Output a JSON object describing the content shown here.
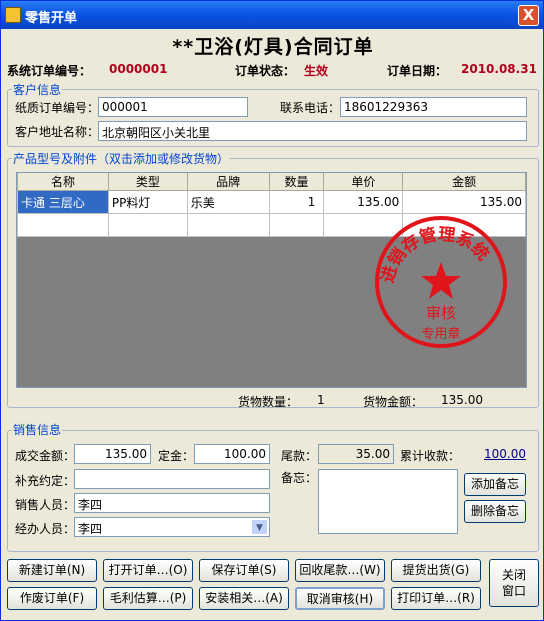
{
  "window": {
    "title": "零售开单",
    "close": "X"
  },
  "doc_title": "**卫浴(灯具)合同订单",
  "header": {
    "order_no_label": "系统订单编号：",
    "order_no": "0000001",
    "status_label": "订单状态：",
    "status": "生效",
    "date_label": "订单日期：",
    "date": "2010.08.31"
  },
  "customer": {
    "legend": "客户信息",
    "paper_no_label": "纸质订单编号：",
    "paper_no": "000001",
    "phone_label": "联系电话：",
    "phone": "18601229363",
    "address_label": "客户地址名称：",
    "address": "北京朝阳区小关北里"
  },
  "products": {
    "legend": "产品型号及附件（双击添加或修改货物）",
    "columns": [
      "名称",
      "类型",
      "品牌",
      "数量",
      "单价",
      "金额"
    ],
    "rows": [
      [
        "卡通 三层心",
        "PP料灯",
        "乐美",
        "1",
        "135.00",
        "135.00"
      ]
    ],
    "qty_label": "货物数量：",
    "qty_total": "1",
    "amount_label": "货物金额：",
    "amount_total": "135.00"
  },
  "stamp": {
    "top_text": "进销存管理系统",
    "mid_text": "审核",
    "bottom_text": "专用章",
    "color": "#e0141b"
  },
  "sales": {
    "legend": "销售信息",
    "deal_label": "成交金额：",
    "deal": "135.00",
    "deposit_label": "定金：",
    "deposit": "100.00",
    "balance_label": "尾款：",
    "balance": "35.00",
    "received_label": "累计收款：",
    "received": "100.00",
    "extra_label": "补充约定：",
    "extra": "",
    "note_label": "备忘：",
    "note": "",
    "seller_label": "销售人员：",
    "seller": "李四",
    "handler_label": "经办人员：",
    "handler": "李四",
    "add_note": "添加备忘",
    "del_note": "删除备忘"
  },
  "buttons": {
    "new": "新建订单(N)",
    "open": "打开订单…(O)",
    "save": "保存订单(S)",
    "collect": "回收尾款…(W)",
    "ship": "提货出货(G)",
    "void": "作废订单(F)",
    "profit": "毛利估算…(P)",
    "install": "安装相关…(A)",
    "cancel_audit": "取消审核(H)",
    "print": "打印订单…(R)",
    "close_line1": "关闭",
    "close_line2": "窗口"
  }
}
